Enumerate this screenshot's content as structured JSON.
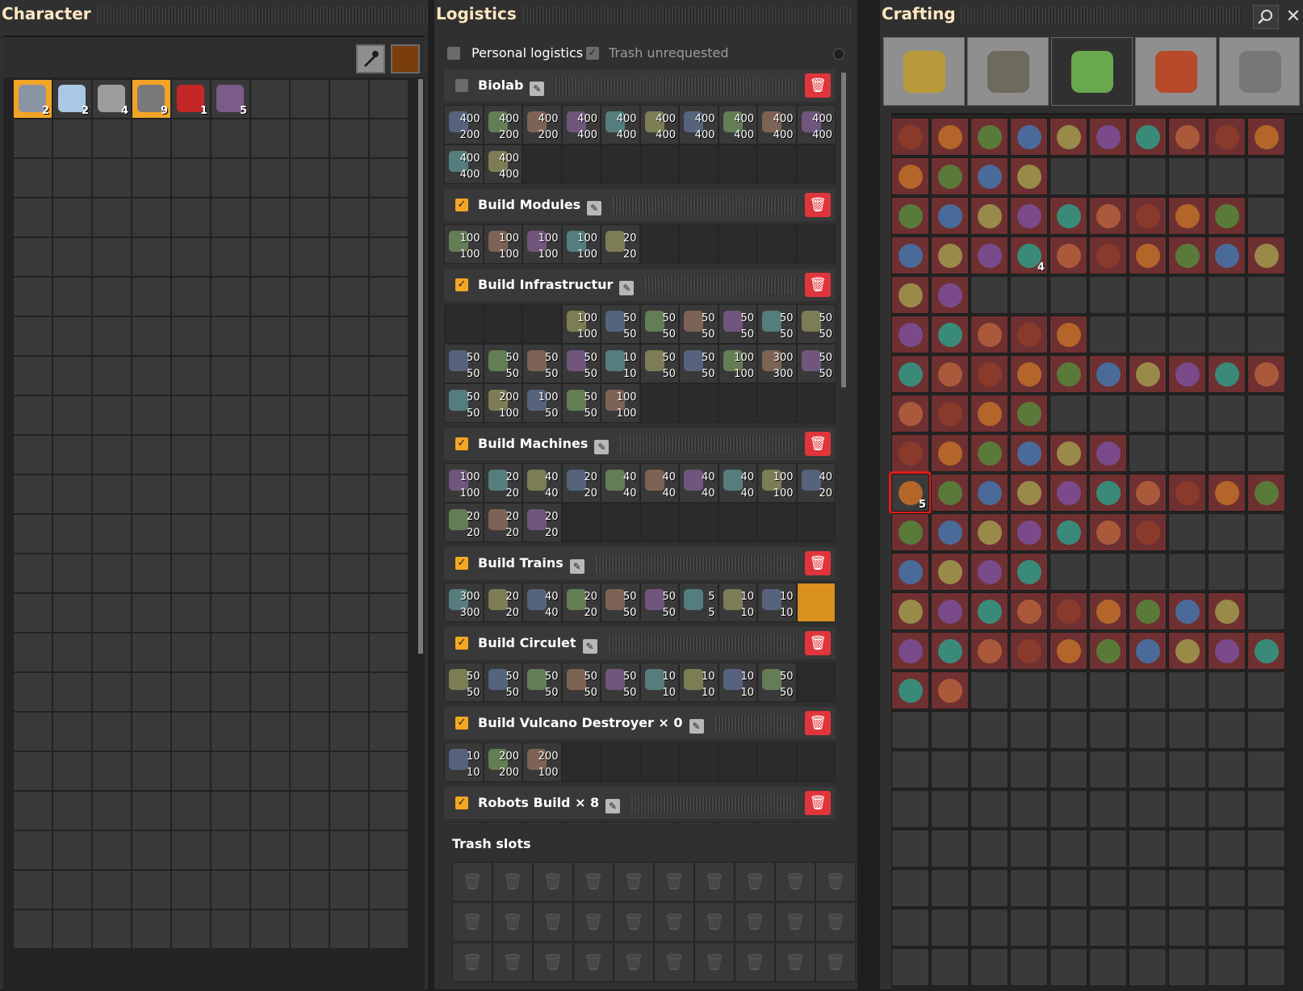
{
  "character": {
    "title": "Character",
    "pipette_icon": "pipette-icon",
    "color_swatch": "#7a3d0c",
    "items": [
      {
        "icon": "iron-plate-icon",
        "color": "#8b94a3",
        "count": "2",
        "highlight": true
      },
      {
        "icon": "ice-icon",
        "color": "#a9c8e3",
        "count": "2",
        "highlight": false
      },
      {
        "icon": "steel-beam-icon",
        "color": "#9c9c9c",
        "count": "4",
        "highlight": false
      },
      {
        "icon": "gear-icon",
        "color": "#7a7a7a",
        "count": "9",
        "highlight": true
      },
      {
        "icon": "electronic-circuit-icon",
        "color": "#c42727",
        "count": "1",
        "highlight": false
      },
      {
        "icon": "robot-part-icon",
        "color": "#7c5a8a",
        "count": "5",
        "highlight": false
      }
    ]
  },
  "logistics": {
    "title": "Logistics",
    "personal_logistics": "Personal logistics",
    "trash_unrequested": "Trash unrequested",
    "sections": [
      {
        "name": "Biolab",
        "checked": false,
        "rows": [
          [
            [
              "400",
              "200"
            ],
            [
              "400",
              "200"
            ],
            [
              "400",
              "200"
            ],
            [
              "400",
              "400"
            ],
            [
              "400",
              "400"
            ],
            [
              "400",
              "400"
            ],
            [
              "400",
              "400"
            ],
            [
              "400",
              "400"
            ],
            [
              "400",
              "400"
            ],
            [
              "400",
              "400"
            ]
          ],
          [
            [
              "400",
              "400"
            ],
            [
              "400",
              "400"
            ],
            null,
            null,
            null,
            null,
            null,
            null,
            null,
            null
          ]
        ]
      },
      {
        "name": "Build Modules",
        "checked": true,
        "rows": [
          [
            [
              "100",
              "100"
            ],
            [
              "100",
              "100"
            ],
            [
              "100",
              "100"
            ],
            [
              "100",
              "100"
            ],
            [
              "20",
              "20"
            ],
            null,
            null,
            null,
            null,
            null
          ]
        ]
      },
      {
        "name": "Build Infrastructur",
        "checked": true,
        "rows": [
          [
            null,
            null,
            null,
            [
              "100",
              "100"
            ],
            [
              "50",
              "50"
            ],
            [
              "50",
              "50"
            ],
            [
              "50",
              "50"
            ],
            [
              "50",
              "50"
            ],
            [
              "50",
              "50"
            ],
            [
              "50",
              "50"
            ]
          ],
          [
            [
              "50",
              "50"
            ],
            [
              "50",
              "50"
            ],
            [
              "50",
              "50"
            ],
            [
              "50",
              "50"
            ],
            [
              "10",
              "10"
            ],
            [
              "50",
              "50"
            ],
            [
              "50",
              "50"
            ],
            [
              "100",
              "100"
            ],
            [
              "300",
              "300"
            ],
            [
              "50",
              "50"
            ]
          ],
          [
            [
              "50",
              "50"
            ],
            [
              "200",
              "100"
            ],
            [
              "100",
              "50"
            ],
            [
              "50",
              "50"
            ],
            [
              "100",
              "100"
            ],
            null,
            null,
            null,
            null,
            null
          ]
        ]
      },
      {
        "name": "Build Machines",
        "checked": true,
        "rows": [
          [
            [
              "100",
              "100"
            ],
            [
              "20",
              "20"
            ],
            [
              "40",
              "40"
            ],
            [
              "20",
              "20"
            ],
            [
              "40",
              "40"
            ],
            [
              "40",
              "40"
            ],
            [
              "40",
              "40"
            ],
            [
              "40",
              "40"
            ],
            [
              "100",
              "100"
            ],
            [
              "40",
              "20"
            ]
          ],
          [
            [
              "20",
              "20"
            ],
            [
              "20",
              "20"
            ],
            [
              "20",
              "20"
            ],
            null,
            null,
            null,
            null,
            null,
            null,
            null
          ]
        ]
      },
      {
        "name": "Build Trains",
        "checked": true,
        "rows": [
          [
            [
              "300",
              "300"
            ],
            [
              "20",
              "20"
            ],
            [
              "40",
              "40"
            ],
            [
              "20",
              "20"
            ],
            [
              "50",
              "50"
            ],
            [
              "50",
              "50"
            ],
            [
              "5",
              "5"
            ],
            [
              "10",
              "10"
            ],
            [
              "10",
              "10"
            ],
            "selected"
          ]
        ]
      },
      {
        "name": "Build Circulet",
        "checked": true,
        "rows": [
          [
            [
              "50",
              "50"
            ],
            [
              "50",
              "50"
            ],
            [
              "50",
              "50"
            ],
            [
              "50",
              "50"
            ],
            [
              "50",
              "50"
            ],
            [
              "10",
              "10"
            ],
            [
              "10",
              "10"
            ],
            [
              "10",
              "10"
            ],
            [
              "50",
              "50"
            ],
            null
          ]
        ]
      },
      {
        "name": "Build Vulcano Destroyer × 0",
        "checked": true,
        "rows": [
          [
            [
              "10",
              "10"
            ],
            [
              "200",
              "200"
            ],
            [
              "200",
              "100"
            ],
            null,
            null,
            null,
            null,
            null,
            null,
            null
          ]
        ]
      },
      {
        "name": "Robots Build × 8",
        "checked": true,
        "rows": []
      }
    ],
    "trash_title": "Trash slots"
  },
  "crafting": {
    "title": "Crafting",
    "search_icon": "search-icon",
    "close_icon": "close-icon",
    "tabs": [
      {
        "icon": "logistics-tab-icon",
        "color": "#b89a3b"
      },
      {
        "icon": "production-tab-icon",
        "color": "#6f6a5e"
      },
      {
        "icon": "intermediate-products-tab-icon",
        "color": "#6aa84f"
      },
      {
        "icon": "space-tab-icon",
        "color": "#b64a2a"
      },
      {
        "icon": "combat-tab-icon",
        "color": "#777777"
      }
    ],
    "highlighted_count": "5",
    "third_row_count": "4"
  }
}
